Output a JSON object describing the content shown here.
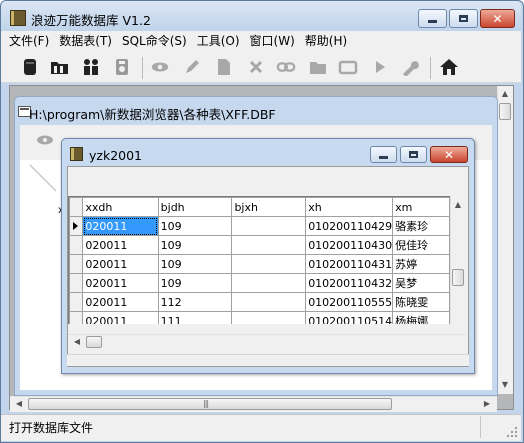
{
  "app": {
    "title": "浪迹万能数据库 V1.2",
    "icon": "book-icon"
  },
  "menu": [
    {
      "label": "文件(F)"
    },
    {
      "label": "数据表(T)"
    },
    {
      "label": "SQL命令(S)"
    },
    {
      "label": "工具(O)"
    },
    {
      "label": "窗口(W)"
    },
    {
      "label": "帮助(H)"
    }
  ],
  "toolbar": {
    "icons": [
      "database-icon",
      "open-folder-icon",
      "users-icon",
      "disk-icon",
      "eye-icon",
      "edit-pencil-icon",
      "page-icon",
      "delete-x-icon",
      "link-icon",
      "folder-icon",
      "window-icon",
      "play-icon",
      "wrench-icon",
      "home-icon"
    ]
  },
  "child_xff": {
    "title": "H:\\program\\新数据浏览器\\各种表\\XFF.DBF"
  },
  "child_yzk": {
    "title": "yzk2001"
  },
  "grid": {
    "columns": [
      "xxdh",
      "bjdh",
      "bjxh",
      "xh",
      "xm"
    ],
    "rows": [
      [
        "020011",
        "109",
        "",
        "010200110429",
        "骆素珍"
      ],
      [
        "020011",
        "109",
        "",
        "010200110430",
        "倪佳玲"
      ],
      [
        "020011",
        "109",
        "",
        "010200110431",
        "苏婷"
      ],
      [
        "020011",
        "109",
        "",
        "010200110432",
        "吴梦"
      ],
      [
        "020011",
        "112",
        "",
        "010200110555",
        "陈晓雯"
      ],
      [
        "020011",
        "111",
        "",
        "010200110514",
        "杨梅娜"
      ]
    ],
    "selected_row": 0,
    "selected_col": 0
  },
  "status": {
    "text": "打开数据库文件"
  },
  "colors": {
    "title_bar": "#c2d5ec",
    "selection": "#3399ff",
    "close_button": "#c9452e"
  }
}
